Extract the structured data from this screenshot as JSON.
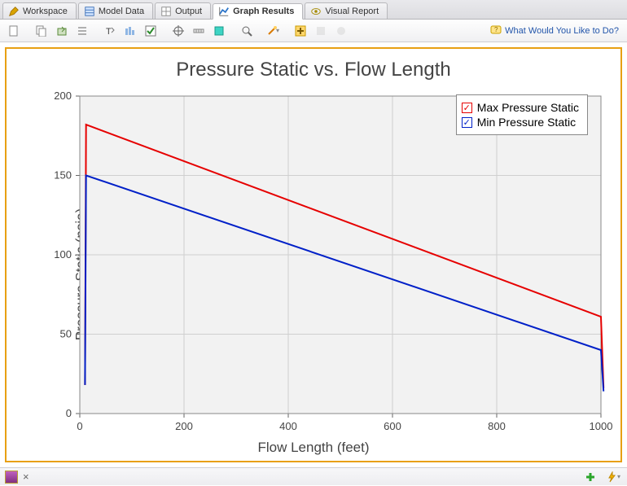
{
  "tabs": {
    "workspace": "Workspace",
    "model_data": "Model Data",
    "output": "Output",
    "graph_results": "Graph Results",
    "visual_report": "Visual Report"
  },
  "toolbar": {
    "help_link": "What Would You Like to Do?"
  },
  "chart_data": {
    "type": "line",
    "title": "Pressure Static vs. Flow Length",
    "xlabel": "Flow Length (feet)",
    "ylabel": "Pressure Static (psia)",
    "xlim": [
      0,
      1000
    ],
    "ylim": [
      0,
      200
    ],
    "xticks": [
      0,
      200,
      400,
      600,
      800,
      1000
    ],
    "yticks": [
      0,
      50,
      100,
      150,
      200
    ],
    "legend_position": "top-right",
    "grid": true,
    "series": [
      {
        "name": "Max Pressure Static",
        "color": "#e60000",
        "x": [
          10,
          12,
          1000,
          1005
        ],
        "values": [
          18,
          182,
          61,
          16
        ]
      },
      {
        "name": "Min Pressure Static",
        "color": "#0020c8",
        "x": [
          10,
          12,
          1000,
          1005
        ],
        "values": [
          18,
          150,
          40,
          14
        ]
      }
    ]
  },
  "bottom_tab": {
    "close_x": "×"
  }
}
